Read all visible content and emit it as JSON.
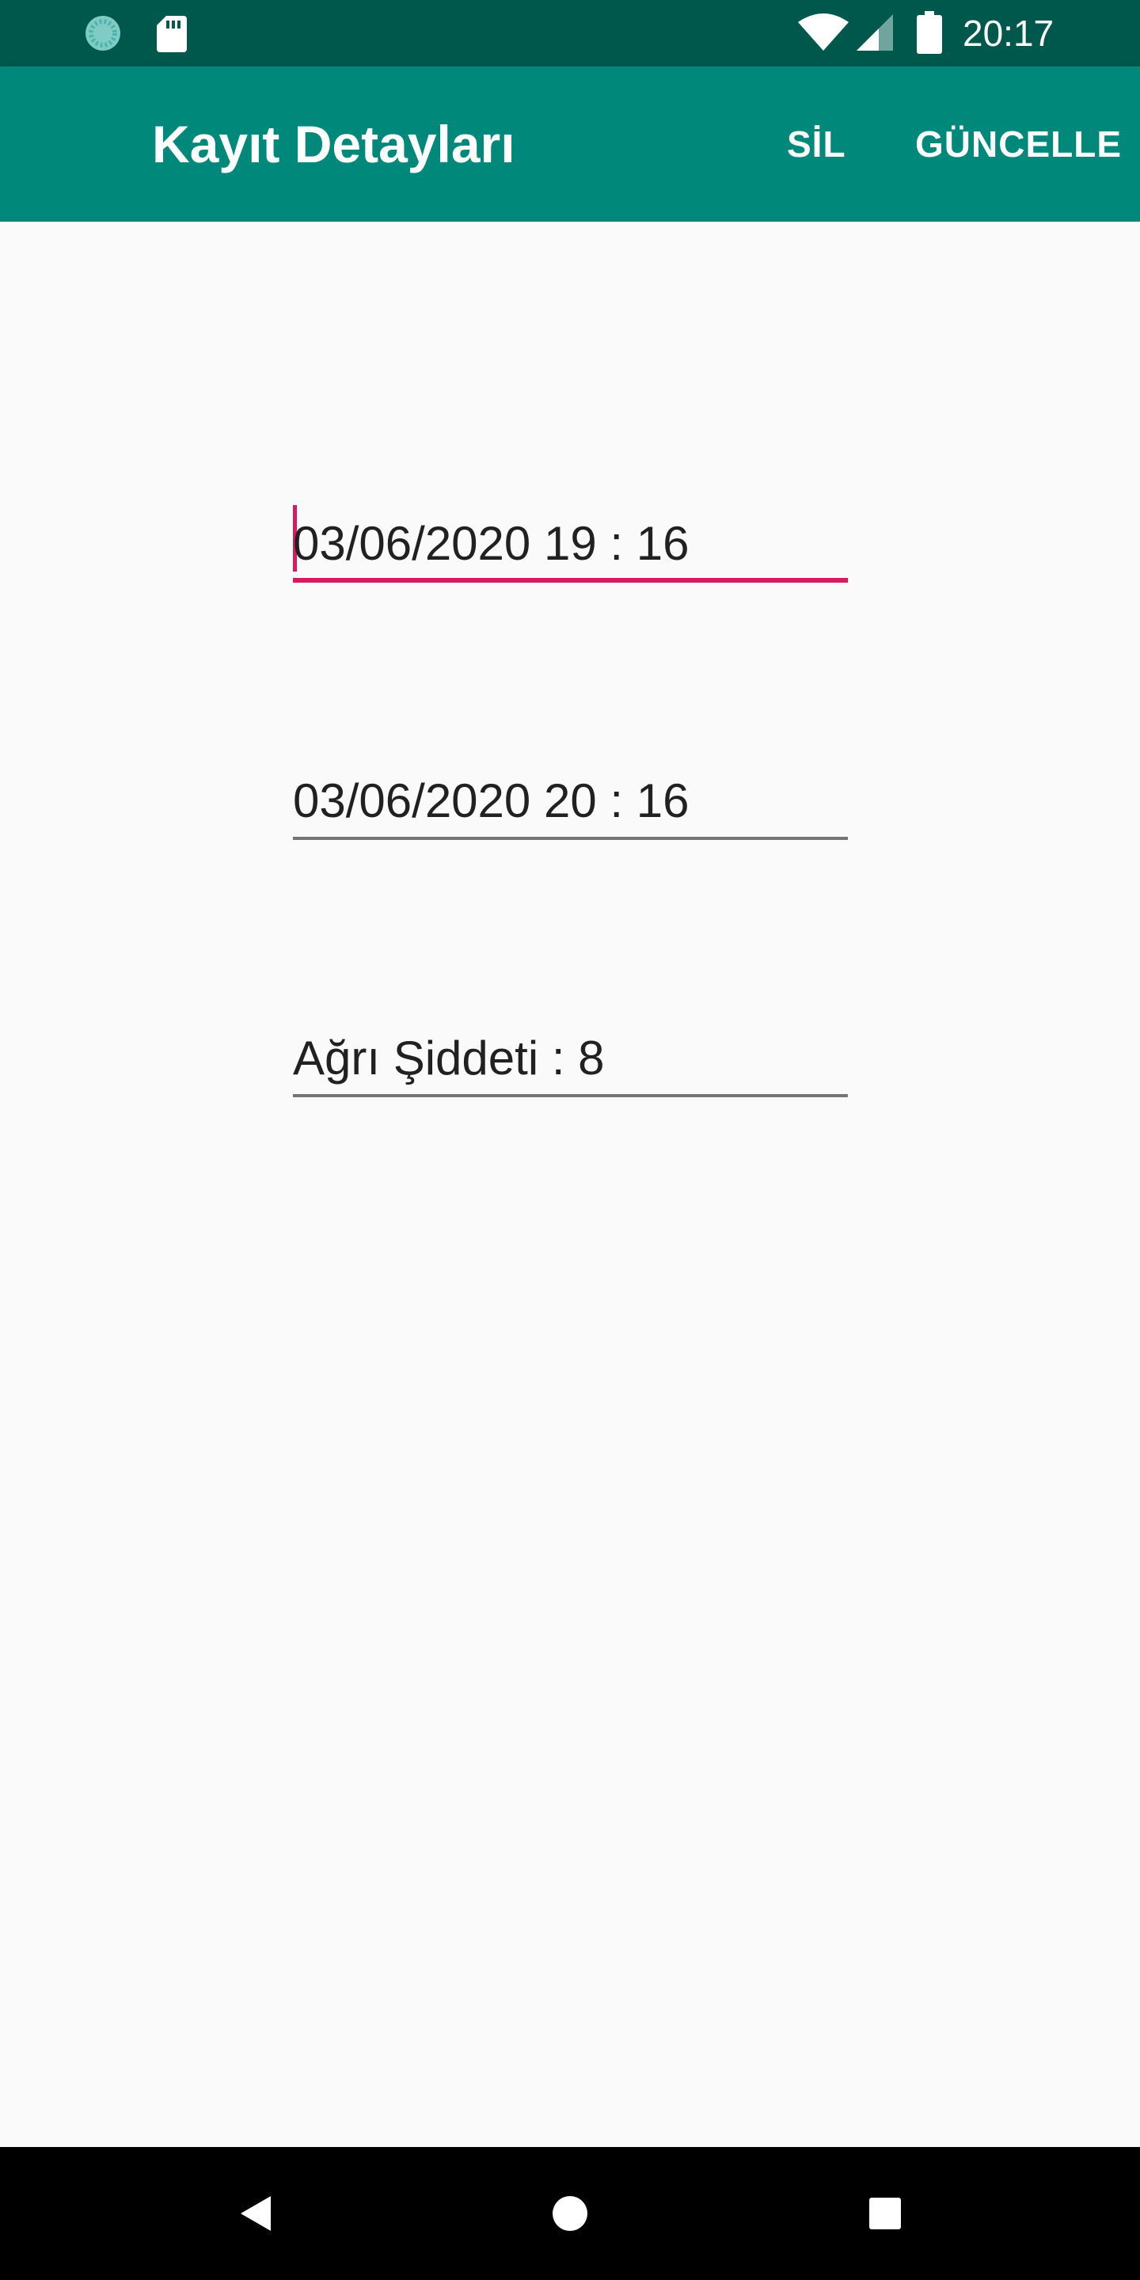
{
  "status_bar": {
    "time": "20:17",
    "icons": [
      "sync-icon",
      "sdcard-icon",
      "wifi-icon",
      "signal-icon",
      "battery-icon"
    ]
  },
  "app_bar": {
    "title": "Kayıt Detayları",
    "actions": {
      "delete_label": "SİL",
      "update_label": "GÜNCELLE"
    },
    "color": "#00897b",
    "status_color": "#00574b"
  },
  "form": {
    "start_time": "03/06/2020 19 : 16",
    "end_time": "03/06/2020 20 : 16",
    "pain_level": "Ağrı Şiddeti : 8",
    "accent_color": "#d81b60"
  },
  "nav_bar": {
    "buttons": [
      "back-icon",
      "home-icon",
      "recents-icon"
    ]
  }
}
